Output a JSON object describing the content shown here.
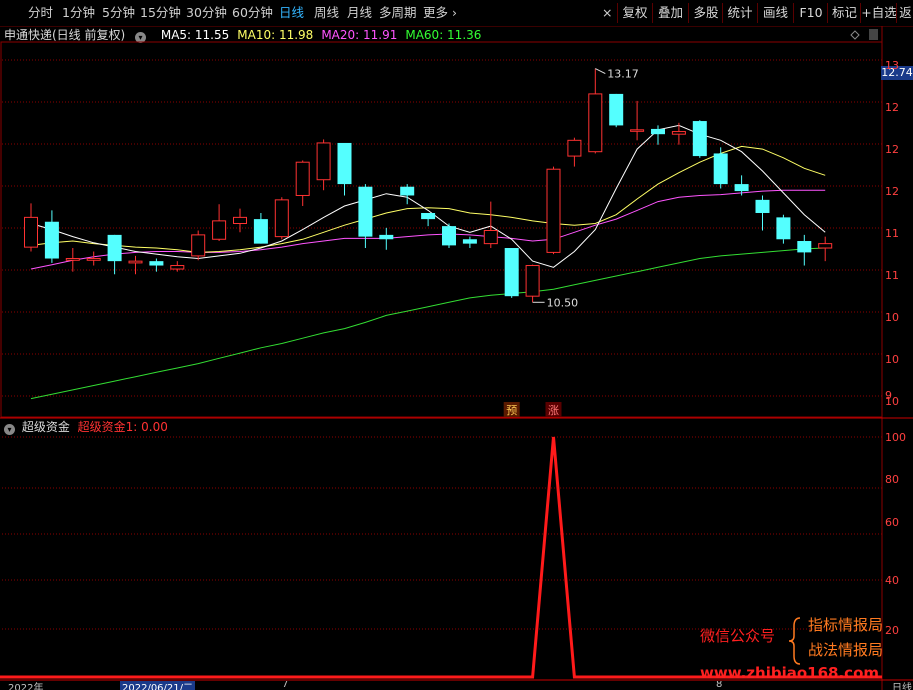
{
  "toolbar": {
    "periods": [
      {
        "label": "分时",
        "active": false
      },
      {
        "label": "1分钟",
        "active": false
      },
      {
        "label": "5分钟",
        "active": false
      },
      {
        "label": "15分钟",
        "active": false
      },
      {
        "label": "30分钟",
        "active": false
      },
      {
        "label": "60分钟",
        "active": false
      },
      {
        "label": "日线",
        "active": true
      },
      {
        "label": "周线",
        "active": false
      },
      {
        "label": "月线",
        "active": false
      },
      {
        "label": "多周期",
        "active": false
      },
      {
        "label": "更多",
        "active": false
      }
    ],
    "tools": [
      "复权",
      "叠加",
      "多股",
      "统计",
      "画线",
      "F10",
      "标记",
      "+自选",
      "返"
    ]
  },
  "main_panel": {
    "stock_title": "申通快递(日线 前复权)",
    "ma": [
      {
        "label": "MA5: 11.55",
        "color": "#ffffff"
      },
      {
        "label": "MA10: 11.98",
        "color": "#ffff66"
      },
      {
        "label": "MA20: 11.91",
        "color": "#ff55ff"
      },
      {
        "label": "MA60: 11.36",
        "color": "#33ff33"
      }
    ],
    "current_price": "12.74",
    "high_label": "13.17",
    "low_label": "10.50",
    "signal_pre": "预",
    "signal_up": "涨",
    "price_axis": [
      "13",
      "12",
      "12",
      "12",
      "11",
      "11",
      "10",
      "10",
      "10",
      "9"
    ]
  },
  "sub_panel": {
    "title": "超级资金",
    "indicator": "超级资金1: 0.00",
    "axis": [
      "100",
      "80",
      "60",
      "40",
      "20"
    ]
  },
  "date_axis": {
    "left": "2022年",
    "selected": "2022/06/21/二",
    "mid": "7",
    "mid2": "8",
    "right": "日线"
  },
  "watermark": {
    "left": "微信公众号",
    "line1": "指标情报局",
    "line2": "战法情报局",
    "url": "www.zhibiao168.com"
  },
  "colors": {
    "up": "#ff3232",
    "down": "#54ffff",
    "grid": "#8b0000",
    "signal": "#ff1a1a"
  },
  "chart_data": {
    "type": "candlestick",
    "price_range": [
      9.27,
      13.45
    ],
    "candles": [
      {
        "o": 11.13,
        "c": 11.47,
        "h": 11.63,
        "l": 11.08
      },
      {
        "o": 11.42,
        "c": 11.0,
        "h": 11.55,
        "l": 10.95
      },
      {
        "o": 10.98,
        "c": 11.0,
        "h": 11.12,
        "l": 10.85
      },
      {
        "o": 10.98,
        "c": 11.0,
        "h": 11.08,
        "l": 10.92
      },
      {
        "o": 11.27,
        "c": 10.97,
        "h": 11.27,
        "l": 10.82
      },
      {
        "o": 10.95,
        "c": 10.97,
        "h": 11.03,
        "l": 10.82
      },
      {
        "o": 10.97,
        "c": 10.92,
        "h": 11.0,
        "l": 10.85
      },
      {
        "o": 10.88,
        "c": 10.92,
        "h": 10.97,
        "l": 10.85
      },
      {
        "o": 11.03,
        "c": 11.27,
        "h": 11.32,
        "l": 10.98
      },
      {
        "o": 11.22,
        "c": 11.43,
        "h": 11.62,
        "l": 11.2
      },
      {
        "o": 11.4,
        "c": 11.47,
        "h": 11.57,
        "l": 11.3
      },
      {
        "o": 11.45,
        "c": 11.17,
        "h": 11.52,
        "l": 11.17
      },
      {
        "o": 11.25,
        "c": 11.67,
        "h": 11.7,
        "l": 11.22
      },
      {
        "o": 11.72,
        "c": 12.1,
        "h": 12.12,
        "l": 11.6
      },
      {
        "o": 11.9,
        "c": 12.32,
        "h": 12.36,
        "l": 11.78
      },
      {
        "o": 12.32,
        "c": 11.85,
        "h": 12.32,
        "l": 11.72
      },
      {
        "o": 11.82,
        "c": 11.25,
        "h": 11.85,
        "l": 11.12
      },
      {
        "o": 11.27,
        "c": 11.22,
        "h": 11.35,
        "l": 11.1
      },
      {
        "o": 11.82,
        "c": 11.72,
        "h": 11.85,
        "l": 11.62
      },
      {
        "o": 11.52,
        "c": 11.45,
        "h": 11.52,
        "l": 11.37
      },
      {
        "o": 11.37,
        "c": 11.15,
        "h": 11.4,
        "l": 11.12
      },
      {
        "o": 11.22,
        "c": 11.17,
        "h": 11.25,
        "l": 11.12
      },
      {
        "o": 11.17,
        "c": 11.32,
        "h": 11.65,
        "l": 11.12
      },
      {
        "o": 11.12,
        "c": 10.57,
        "h": 11.12,
        "l": 10.55
      },
      {
        "o": 10.57,
        "c": 10.92,
        "h": 10.93,
        "l": 10.5
      },
      {
        "o": 11.07,
        "c": 12.02,
        "h": 12.05,
        "l": 11.05
      },
      {
        "o": 12.17,
        "c": 12.35,
        "h": 12.38,
        "l": 12.05
      },
      {
        "o": 12.22,
        "c": 12.88,
        "h": 13.17,
        "l": 12.2
      },
      {
        "o": 12.88,
        "c": 12.52,
        "h": 12.88,
        "l": 12.5
      },
      {
        "o": 12.47,
        "c": 12.47,
        "h": 12.8,
        "l": 12.35
      },
      {
        "o": 12.48,
        "c": 12.42,
        "h": 12.52,
        "l": 12.3
      },
      {
        "o": 12.42,
        "c": 12.45,
        "h": 12.55,
        "l": 12.3
      },
      {
        "o": 12.57,
        "c": 12.17,
        "h": 12.58,
        "l": 12.15
      },
      {
        "o": 12.2,
        "c": 11.85,
        "h": 12.27,
        "l": 11.8
      },
      {
        "o": 11.85,
        "c": 11.77,
        "h": 11.95,
        "l": 11.72
      },
      {
        "o": 11.67,
        "c": 11.52,
        "h": 11.72,
        "l": 11.32
      },
      {
        "o": 11.47,
        "c": 11.22,
        "h": 11.5,
        "l": 11.17
      },
      {
        "o": 11.2,
        "c": 11.07,
        "h": 11.27,
        "l": 10.92
      },
      {
        "o": 11.12,
        "c": 11.17,
        "h": 11.25,
        "l": 10.97
      }
    ],
    "ma5": [
      11.4,
      11.33,
      11.25,
      11.18,
      11.13,
      11.08,
      11.05,
      11.02,
      11.0,
      11.03,
      11.06,
      11.12,
      11.2,
      11.33,
      11.47,
      11.6,
      11.67,
      11.74,
      11.7,
      11.55,
      11.37,
      11.3,
      11.37,
      11.22,
      10.97,
      10.9,
      11.08,
      11.33,
      11.8,
      12.25,
      12.47,
      12.52,
      12.42,
      12.35,
      12.22,
      12.0,
      11.75,
      11.5,
      11.3
    ],
    "ma10": [
      11.15,
      11.18,
      11.2,
      11.17,
      11.15,
      11.13,
      11.12,
      11.1,
      11.07,
      11.08,
      11.1,
      11.13,
      11.17,
      11.22,
      11.3,
      11.38,
      11.45,
      11.52,
      11.57,
      11.58,
      11.57,
      11.52,
      11.5,
      11.47,
      11.43,
      11.4,
      11.38,
      11.4,
      11.5,
      11.68,
      11.85,
      11.98,
      12.1,
      12.2,
      12.28,
      12.25,
      12.15,
      12.03,
      11.95
    ],
    "ma20": [
      10.88,
      10.93,
      10.98,
      11.02,
      11.05,
      11.07,
      11.08,
      11.08,
      11.07,
      11.07,
      11.08,
      11.1,
      11.13,
      11.17,
      11.2,
      11.23,
      11.23,
      11.23,
      11.25,
      11.27,
      11.28,
      11.27,
      11.25,
      11.23,
      11.2,
      11.22,
      11.3,
      11.38,
      11.45,
      11.55,
      11.65,
      11.7,
      11.72,
      11.73,
      11.75,
      11.77,
      11.78,
      11.78,
      11.78
    ],
    "ma60": [
      9.4,
      9.45,
      9.5,
      9.55,
      9.6,
      9.65,
      9.7,
      9.75,
      9.8,
      9.86,
      9.92,
      9.98,
      10.03,
      10.09,
      10.15,
      10.2,
      10.27,
      10.35,
      10.4,
      10.45,
      10.5,
      10.55,
      10.58,
      10.6,
      10.62,
      10.65,
      10.7,
      10.75,
      10.8,
      10.85,
      10.9,
      10.95,
      11.0,
      11.03,
      11.05,
      11.07,
      11.09,
      11.11,
      11.12
    ],
    "indicator": {
      "name": "超级资金1",
      "y_range": [
        0,
        100
      ],
      "values": [
        0,
        0,
        0,
        0,
        0,
        0,
        0,
        0,
        0,
        0,
        0,
        0,
        0,
        0,
        0,
        0,
        0,
        0,
        0,
        0,
        0,
        0,
        0,
        0,
        0,
        100,
        0,
        0,
        0,
        0,
        0,
        0,
        0,
        0,
        0,
        0,
        0,
        0,
        0
      ]
    }
  }
}
